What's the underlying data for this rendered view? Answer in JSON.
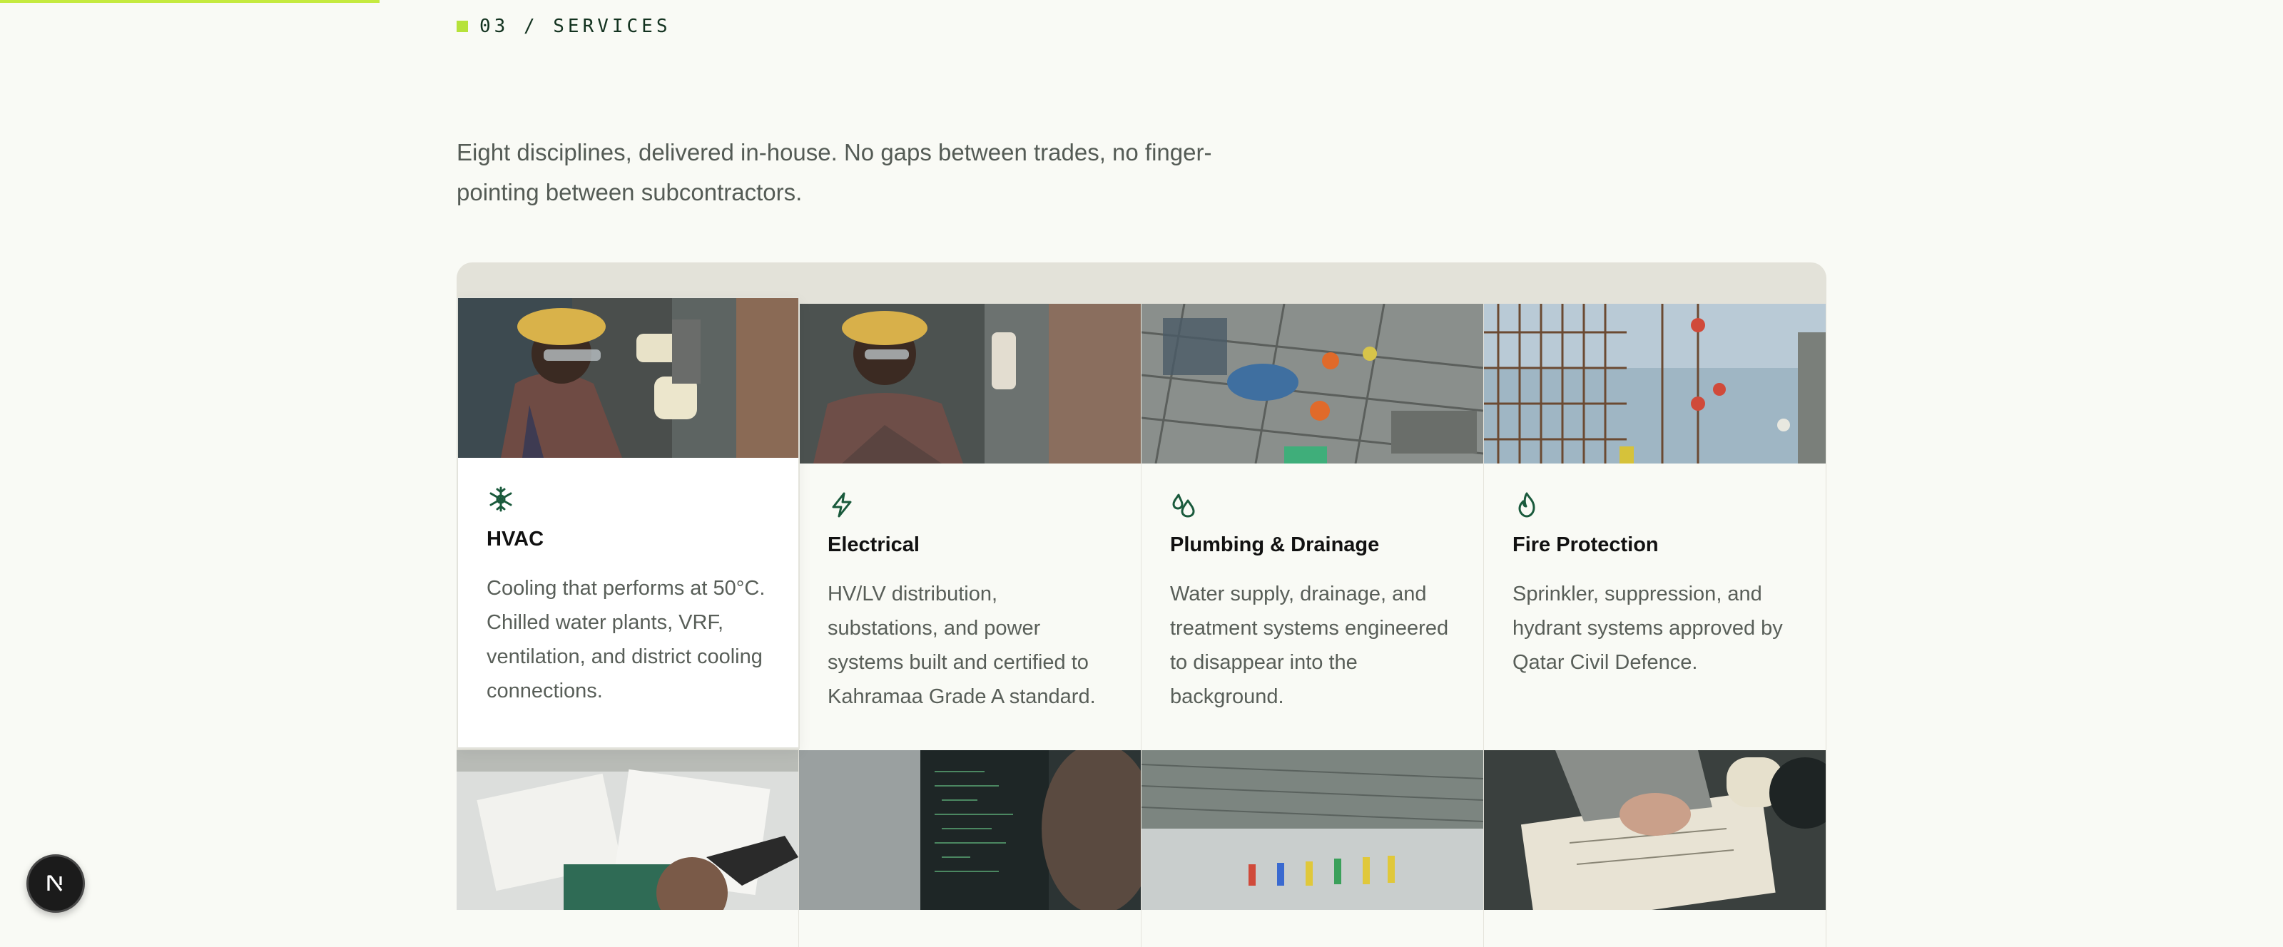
{
  "section": {
    "label": "03 / SERVICES"
  },
  "intro": "Eight disciplines, delivered in-house. No gaps between trades, no finger-pointing between subcontractors.",
  "services": [
    {
      "icon": "snowflake-icon",
      "title": "HVAC",
      "description": "Cooling that performs at 50°C. Chilled water plants, VRF, ventilation, and district cooling connections."
    },
    {
      "icon": "lightning-icon",
      "title": "Electrical",
      "description": "HV/LV distribution, substations, and power systems built and certified to Kahramaa Grade A standard."
    },
    {
      "icon": "droplets-icon",
      "title": "Plumbing & Drainage",
      "description": "Water supply, drainage, and treatment systems engineered to disappear into the background."
    },
    {
      "icon": "flame-icon",
      "title": "Fire Protection",
      "description": "Sprinkler, suppression, and hydrant systems approved by Qatar Civil Defence."
    }
  ],
  "colors": {
    "accent": "#c5ea3f",
    "icon": "#1a5a3c",
    "background": "#f9faf5"
  },
  "badge": {
    "letter": "N"
  }
}
